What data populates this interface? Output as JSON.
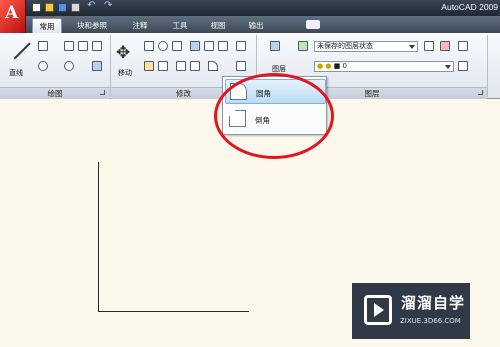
{
  "app": {
    "title": "AutoCAD 2009",
    "logo_letter": "A"
  },
  "quick_access": {
    "icons": [
      "new-icon",
      "open-icon",
      "save-icon",
      "print-icon",
      "undo-icon",
      "redo-icon"
    ]
  },
  "tabs": [
    {
      "label": "常用",
      "active": true
    },
    {
      "label": "块和参照"
    },
    {
      "label": "注释"
    },
    {
      "label": "工具"
    },
    {
      "label": "视图"
    },
    {
      "label": "输出"
    }
  ],
  "panels": {
    "draw": {
      "title": "绘图",
      "line_label": "直线"
    },
    "modify": {
      "title": "修改",
      "move_label": "移动"
    },
    "layers": {
      "title": "图层",
      "layer_label": "图层",
      "state_value": "未保存的图层状态",
      "layer_value": "0"
    }
  },
  "flyout": {
    "items": [
      {
        "label": "圆角",
        "selected": true
      },
      {
        "label": "倒角",
        "selected": false
      }
    ]
  },
  "watermark": {
    "brand": "溜溜自学",
    "url": "ZIXUE.3D66.COM"
  },
  "colors": {
    "highlight": "#e3141c",
    "canvas": "#fcf8ec",
    "logo_red": "#cc1a1a"
  }
}
